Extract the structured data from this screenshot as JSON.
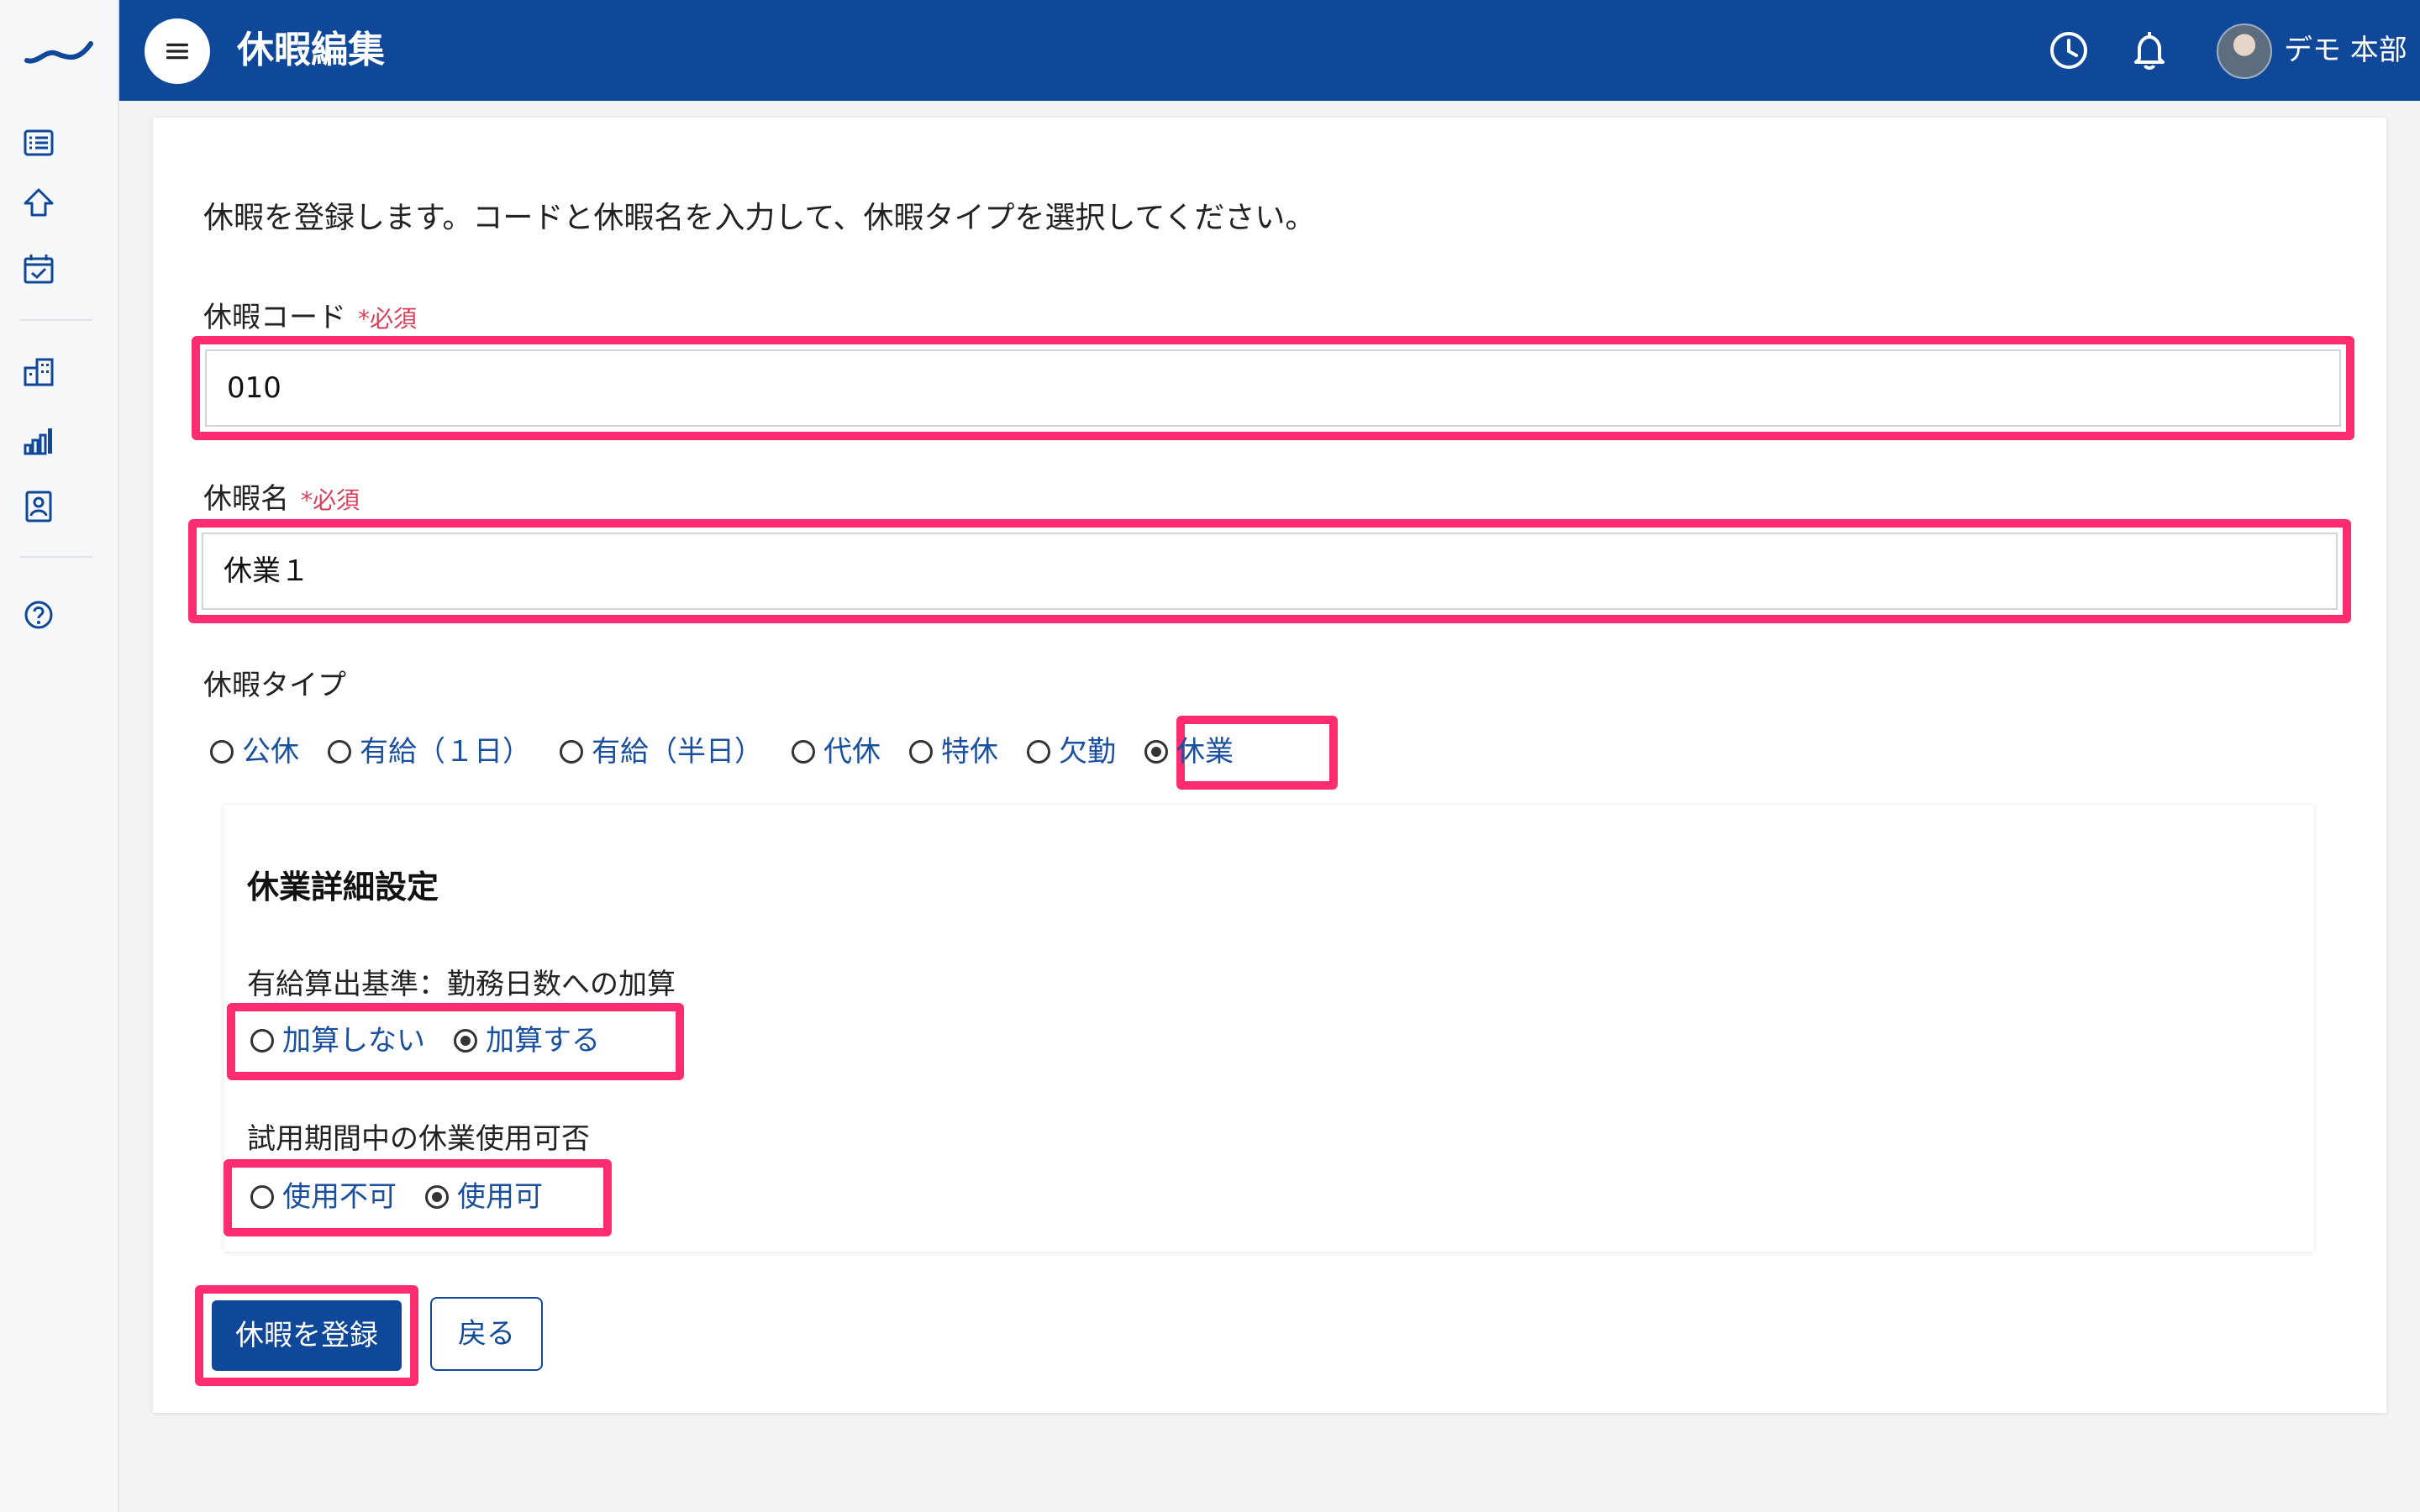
{
  "app": {
    "title": "休暇編集"
  },
  "header": {
    "user_name": "デモ 本部",
    "icons": [
      "clock-icon",
      "bell-icon"
    ]
  },
  "sidebar": {
    "items": [
      {
        "name": "list-icon"
      },
      {
        "name": "home-icon"
      },
      {
        "name": "calendar-check-icon"
      },
      {
        "name": "building-icon"
      },
      {
        "name": "bar-chart-icon"
      },
      {
        "name": "id-card-icon"
      },
      {
        "name": "help-icon"
      }
    ]
  },
  "form": {
    "intro": "休暇を登録します。コードと休暇名を入力して、休暇タイプを選択してください。",
    "code_label": "休暇コード",
    "code_required": "*必須",
    "code_value": "010",
    "name_label": "休暇名",
    "name_required": "*必須",
    "name_value": "休業１",
    "type_label": "休暇タイプ",
    "types": [
      "公休",
      "有給（１日）",
      "有給（半日）",
      "代休",
      "特休",
      "欠勤",
      "休業"
    ],
    "selected_type": "休業"
  },
  "detail": {
    "title": "休業詳細設定",
    "paid_basis_label": "有給算出基準：勤務日数への加算",
    "paid_basis_options": [
      "加算しない",
      "加算する"
    ],
    "paid_basis_selected": "加算する",
    "trial_label": "試用期間中の休業使用可否",
    "trial_options": [
      "使用不可",
      "使用可"
    ],
    "trial_selected": "使用可"
  },
  "actions": {
    "submit_label": "休暇を登録",
    "back_label": "戻る"
  },
  "colors": {
    "header_bg": "#0f4799",
    "highlight": "#ff2d6f",
    "link": "#1a4f9e",
    "required": "#d93f5b"
  }
}
